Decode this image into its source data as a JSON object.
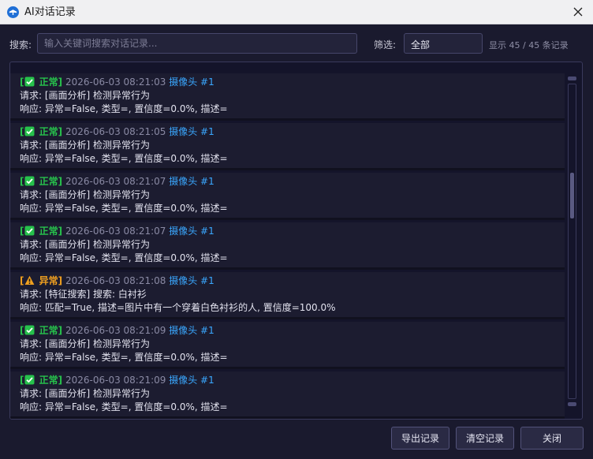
{
  "window": {
    "title": "AI对话记录",
    "icon": "app-logo-icon",
    "close_icon": "close-icon"
  },
  "toolbar": {
    "search_label": "搜索:",
    "search_placeholder": "输入关键词搜索对话记录...",
    "search_value": "",
    "filter_label": "筛选:",
    "filter_value": "全部",
    "count_text": "显示 45 / 45 条记录"
  },
  "colors": {
    "ok": "#27c24c",
    "warn": "#f0a020",
    "camera": "#3aa8ff",
    "timestamp": "#8a8aa4",
    "background": "#1a1a2e"
  },
  "entries": [
    {
      "status": "正常",
      "kind": "ok",
      "time": "2026-06-03 08:21:03",
      "camera": "摄像头 #1",
      "request": "请求: [画面分析] 检测异常行为",
      "response": "响应: 异常=False, 类型=, 置信度=0.0%, 描述="
    },
    {
      "status": "正常",
      "kind": "ok",
      "time": "2026-06-03 08:21:05",
      "camera": "摄像头 #1",
      "request": "请求: [画面分析] 检测异常行为",
      "response": "响应: 异常=False, 类型=, 置信度=0.0%, 描述="
    },
    {
      "status": "正常",
      "kind": "ok",
      "time": "2026-06-03 08:21:07",
      "camera": "摄像头 #1",
      "request": "请求: [画面分析] 检测异常行为",
      "response": "响应: 异常=False, 类型=, 置信度=0.0%, 描述="
    },
    {
      "status": "正常",
      "kind": "ok",
      "time": "2026-06-03 08:21:07",
      "camera": "摄像头 #1",
      "request": "请求: [画面分析] 检测异常行为",
      "response": "响应: 异常=False, 类型=, 置信度=0.0%, 描述="
    },
    {
      "status": "异常",
      "kind": "warn",
      "time": "2026-06-03 08:21:08",
      "camera": "摄像头 #1",
      "request": "请求: [特征搜索] 搜索: 白衬衫",
      "response": "响应: 匹配=True, 描述=图片中有一个穿着白色衬衫的人, 置信度=100.0%"
    },
    {
      "status": "正常",
      "kind": "ok",
      "time": "2026-06-03 08:21:09",
      "camera": "摄像头 #1",
      "request": "请求: [画面分析] 检测异常行为",
      "response": "响应: 异常=False, 类型=, 置信度=0.0%, 描述="
    },
    {
      "status": "正常",
      "kind": "ok",
      "time": "2026-06-03 08:21:09",
      "camera": "摄像头 #1",
      "request": "请求: [画面分析] 检测异常行为",
      "response": "响应: 异常=False, 类型=, 置信度=0.0%, 描述="
    }
  ],
  "scroll": {
    "position_fraction": 0.33
  },
  "buttons": {
    "export": "导出记录",
    "clear": "清空记录",
    "close": "关闭"
  }
}
